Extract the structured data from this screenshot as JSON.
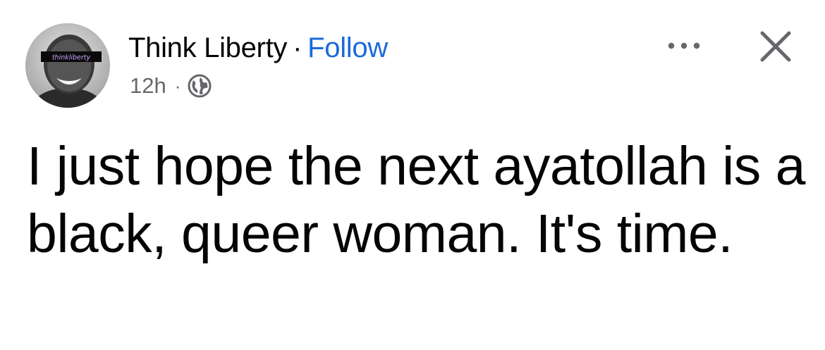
{
  "post": {
    "author": {
      "name": "Think Liberty",
      "avatar_banner_text": "thinkliberty"
    },
    "separator": "·",
    "follow_label": "Follow",
    "timestamp": "12h",
    "meta_separator": "·",
    "privacy_icon": "globe-icon",
    "text": "I just hope the next ayatollah is a black, queer woman. It's time."
  },
  "actions": {
    "more_icon": "more-dots-icon",
    "close_icon": "close-icon"
  },
  "colors": {
    "follow": "#1b6ad9",
    "meta": "#65676b",
    "text": "#050505"
  }
}
